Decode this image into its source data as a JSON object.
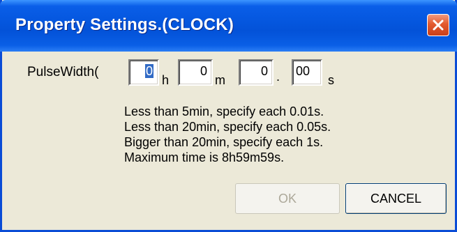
{
  "window": {
    "title": "Property Settings.(CLOCK)"
  },
  "pulse_width": {
    "label": "PulseWidth(",
    "hours": "0",
    "hours_unit": "h",
    "minutes": "0",
    "minutes_unit": "m",
    "seconds": "0",
    "separator": ".",
    "hundredths": "00",
    "seconds_unit": "s"
  },
  "info_lines": [
    "Less than 5min, specify each 0.01s.",
    "Less than 20min, specify each 0.05s.",
    "Bigger than 20min, specify each 1s.",
    "Maximum time is 8h59m59s."
  ],
  "buttons": {
    "ok": "OK",
    "cancel": "CANCEL",
    "ok_enabled": false
  },
  "icons": {
    "close": "close-icon"
  },
  "colors": {
    "titlebar": "#0352d8",
    "close": "#e35a2e",
    "selection": "#316ac5"
  }
}
